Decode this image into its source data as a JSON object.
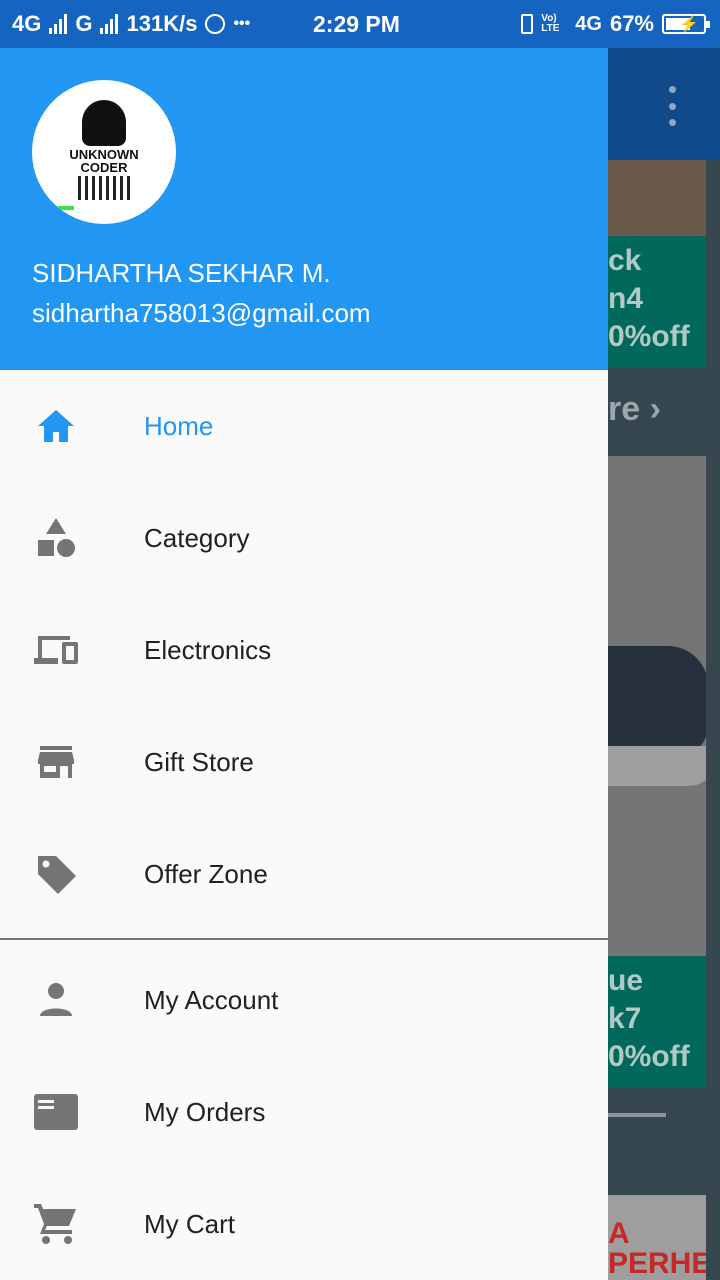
{
  "status_bar": {
    "net1": "4G",
    "net2": "G",
    "speed": "131K/s",
    "more": "•••",
    "time": "2:29 PM",
    "volte": "Vo) LTE",
    "net3": "4G",
    "battery_text": "67%",
    "battery_level": 0.67
  },
  "header": {
    "avatar_logo_text": [
      "UNKNOWN",
      "CODER"
    ],
    "name": "SIDHARTHA SEKHAR M.",
    "email": "sidhartha758013@gmail.com"
  },
  "menu": {
    "items": [
      {
        "label": "Home",
        "icon": "home-icon",
        "active": true
      },
      {
        "label": "Category",
        "icon": "category-icon"
      },
      {
        "label": "Electronics",
        "icon": "devices-icon"
      },
      {
        "label": "Gift Store",
        "icon": "store-icon"
      },
      {
        "label": "Offer Zone",
        "icon": "tag-icon"
      }
    ],
    "account_items": [
      {
        "label": "My Account",
        "icon": "person-icon"
      },
      {
        "label": "My Orders",
        "icon": "orders-icon"
      },
      {
        "label": "My Cart",
        "icon": "cart-icon"
      }
    ]
  },
  "background": {
    "card1": [
      "ck",
      "n4",
      "0%off"
    ],
    "more": "re ›",
    "card2": [
      "ue",
      "k7",
      "0%off"
    ],
    "bottom": [
      "A",
      "PERHE"
    ]
  },
  "colors": {
    "primary": "#2196f3",
    "status_bar": "#1565c0",
    "drawer_bg": "#fafafa",
    "icon_gray": "#757575"
  }
}
